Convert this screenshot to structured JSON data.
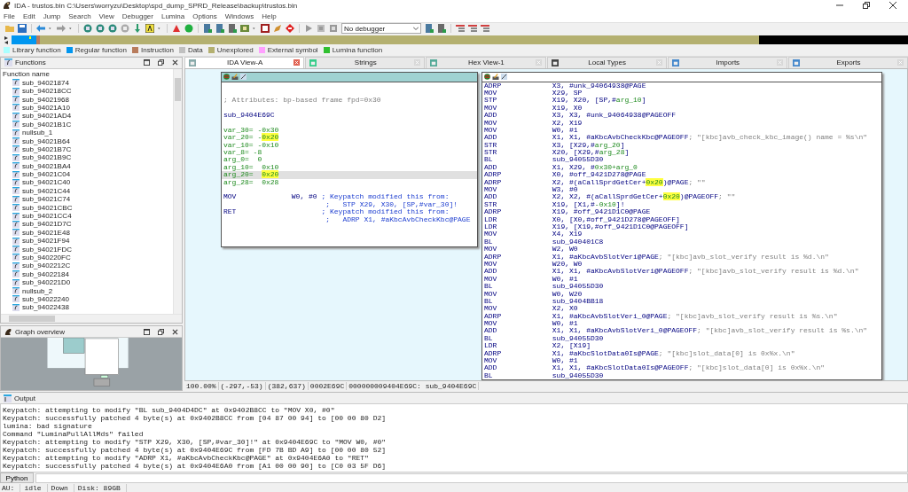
{
  "window": {
    "title": "IDA - trustos.bin C:\\Users\\worryzu\\Desktop\\spd_dump_SPRD_Release\\backup\\trustos.bin"
  },
  "menu": [
    "File",
    "Edit",
    "Jump",
    "Search",
    "View",
    "Debugger",
    "Lumina",
    "Options",
    "Windows",
    "Help"
  ],
  "toolbar": {
    "debugger": "No debugger"
  },
  "legend": [
    {
      "label": "Library function",
      "color": "#aaffff"
    },
    {
      "label": "Regular function",
      "color": "#0096f0"
    },
    {
      "label": "Instruction",
      "color": "#b87c5c"
    },
    {
      "label": "Data",
      "color": "#c0c0c0"
    },
    {
      "label": "Unexplored",
      "color": "#b4b070"
    },
    {
      "label": "External symbol",
      "color": "#ffa0ff"
    },
    {
      "label": "Lumina function",
      "color": "#30c030"
    }
  ],
  "functions": {
    "title": "Functions",
    "column": "Function name",
    "items": [
      "sub_94021874",
      "sub_940218CC",
      "sub_94021968",
      "sub_94021A10",
      "sub_94021AD4",
      "sub_94021B1C",
      "nullsub_1",
      "sub_94021B64",
      "sub_94021B7C",
      "sub_94021B9C",
      "sub_94021BA4",
      "sub_94021C04",
      "sub_94021C40",
      "sub_94021C44",
      "sub_94021C74",
      "sub_94021CBC",
      "sub_94021CC4",
      "sub_94021D7C",
      "sub_94021E48",
      "sub_94021F94",
      "sub_94021FDC",
      "sub_940220FC",
      "sub_9402212C",
      "sub_94022184",
      "sub_940221D0",
      "nullsub_2",
      "sub_94022240",
      "sub_94022438"
    ]
  },
  "graph_overview": {
    "title": "Graph overview"
  },
  "tabs": [
    {
      "label": "IDA View-A",
      "selected": true
    },
    {
      "label": "Strings",
      "selected": false
    },
    {
      "label": "Hex View-1",
      "selected": false
    },
    {
      "label": "Local Types",
      "selected": false
    },
    {
      "label": "Imports",
      "selected": false
    },
    {
      "label": "Exports",
      "selected": false
    }
  ],
  "graph": {
    "blocks": [
      {
        "selected": true,
        "lines": [
          {
            "kind": "gap",
            "selected": false
          },
          {
            "kind": "gap",
            "selected": false
          },
          {
            "kind": "text",
            "selected": false,
            "parts": [
              {
                "kind": "attr",
                "text": "; Attributes: bp-based frame fpd=0x30"
              }
            ]
          },
          {
            "kind": "gap",
            "selected": false
          },
          {
            "kind": "text",
            "selected": false,
            "parts": [
              {
                "kind": "label",
                "text": "sub_9404E69C"
              }
            ]
          },
          {
            "kind": "gap",
            "selected": false
          },
          {
            "kind": "text",
            "selected": false,
            "parts": [
              {
                "kind": "name",
                "text": "var_30= -0x30"
              }
            ]
          },
          {
            "kind": "text",
            "selected": false,
            "parts": [
              {
                "kind": "name",
                "text": "var_20= -"
              },
              {
                "kind": "hl",
                "text": "0x20"
              }
            ]
          },
          {
            "kind": "text",
            "selected": false,
            "parts": [
              {
                "kind": "name",
                "text": "var_10= -0x10"
              }
            ]
          },
          {
            "kind": "text",
            "selected": false,
            "parts": [
              {
                "kind": "name",
                "text": "var_8= -8"
              }
            ]
          },
          {
            "kind": "text",
            "selected": false,
            "parts": [
              {
                "kind": "name",
                "text": "arg_0=  0"
              }
            ]
          },
          {
            "kind": "text",
            "selected": false,
            "parts": [
              {
                "kind": "name",
                "text": "arg_10=  0x10"
              }
            ]
          },
          {
            "kind": "text",
            "selected": true,
            "parts": [
              {
                "kind": "name",
                "text": "arg_20=  "
              },
              {
                "kind": "hl",
                "text": "0x20"
              }
            ]
          },
          {
            "kind": "text",
            "selected": false,
            "parts": [
              {
                "kind": "name",
                "text": "arg_28=  0x28"
              }
            ]
          },
          {
            "kind": "gap",
            "selected": false
          },
          {
            "kind": "insn",
            "selected": false,
            "mnemonic": "MOV",
            "parts": [
              {
                "kind": "op",
                "text": "W0, #0"
              },
              {
                "kind": "user",
                "text": "; Keypatch modified this from:"
              }
            ]
          },
          {
            "kind": "cont",
            "selected": false,
            "parts": [
              {
                "kind": "user",
                "text": ";   STP X29, X30, [SP,#var_30]!"
              }
            ]
          },
          {
            "kind": "insn",
            "selected": false,
            "mnemonic": "RET",
            "parts": [
              {
                "kind": "user",
                "text": "; Keypatch modified this from:"
              }
            ]
          },
          {
            "kind": "cont",
            "selected": false,
            "parts": [
              {
                "kind": "user",
                "text": ";   ADRP X1, #aKbcAvbCheckKbc@PAGE"
              }
            ]
          }
        ]
      },
      {
        "selected": false,
        "lines": [
          {
            "kind": "insn",
            "selected": false,
            "mnemonic": "ADRP",
            "parts": [
              {
                "kind": "op",
                "text": "X3, #unk_94064938@PAGE"
              }
            ]
          },
          {
            "kind": "insn",
            "selected": false,
            "mnemonic": "MOV",
            "parts": [
              {
                "kind": "op",
                "text": "X29, SP"
              }
            ]
          },
          {
            "kind": "insn",
            "selected": false,
            "mnemonic": "STP",
            "parts": [
              {
                "kind": "op",
                "text": "X19, X20, [SP,#"
              },
              {
                "kind": "name",
                "text": "arg_10"
              },
              {
                "kind": "op",
                "text": "]"
              }
            ]
          },
          {
            "kind": "insn",
            "selected": false,
            "mnemonic": "MOV",
            "parts": [
              {
                "kind": "op",
                "text": "X19, X0"
              }
            ]
          },
          {
            "kind": "insn",
            "selected": false,
            "mnemonic": "ADD",
            "parts": [
              {
                "kind": "op",
                "text": "X3, X3, #unk_94064938@PAGEOFF"
              }
            ]
          },
          {
            "kind": "insn",
            "selected": false,
            "mnemonic": "MOV",
            "parts": [
              {
                "kind": "op",
                "text": "X2, X19"
              }
            ]
          },
          {
            "kind": "insn",
            "selected": false,
            "mnemonic": "MOV",
            "parts": [
              {
                "kind": "op",
                "text": "W0, #1"
              }
            ]
          },
          {
            "kind": "insn",
            "selected": false,
            "mnemonic": "ADD",
            "parts": [
              {
                "kind": "op",
                "text": "X1, X1, #aKbcAvbCheckKbc@PAGEOFF"
              },
              {
                "kind": "str",
                "text": "; \"[kbc]avb_check_kbc_image() name = %s\\n\""
              }
            ]
          },
          {
            "kind": "insn",
            "selected": false,
            "mnemonic": "STR",
            "parts": [
              {
                "kind": "op",
                "text": "X3, [X29,#"
              },
              {
                "kind": "name",
                "text": "arg_20"
              },
              {
                "kind": "op",
                "text": "]"
              }
            ]
          },
          {
            "kind": "insn",
            "selected": false,
            "mnemonic": "STR",
            "parts": [
              {
                "kind": "op",
                "text": "X20, [X29,#"
              },
              {
                "kind": "name",
                "text": "arg_28"
              },
              {
                "kind": "op",
                "text": "]"
              }
            ]
          },
          {
            "kind": "insn",
            "selected": false,
            "mnemonic": "BL",
            "parts": [
              {
                "kind": "op",
                "text": "sub_94055D30"
              }
            ]
          },
          {
            "kind": "insn",
            "selected": false,
            "mnemonic": "ADD",
            "parts": [
              {
                "kind": "op",
                "text": "X1, X29, #"
              },
              {
                "kind": "name",
                "text": "0x30+arg_0"
              }
            ]
          },
          {
            "kind": "insn",
            "selected": false,
            "mnemonic": "ADRP",
            "parts": [
              {
                "kind": "op",
                "text": "X0, #off_9421D278@PAGE"
              }
            ]
          },
          {
            "kind": "insn",
            "selected": false,
            "mnemonic": "ADRP",
            "parts": [
              {
                "kind": "op",
                "text": "X2, #(aCallSprdGetCer+"
              },
              {
                "kind": "hl",
                "text": "0x20"
              },
              {
                "kind": "op",
                "text": ")@PAGE"
              },
              {
                "kind": "str",
                "text": "; \"\""
              }
            ]
          },
          {
            "kind": "insn",
            "selected": false,
            "mnemonic": "MOV",
            "parts": [
              {
                "kind": "op",
                "text": "W3, #0"
              }
            ]
          },
          {
            "kind": "insn",
            "selected": false,
            "mnemonic": "ADD",
            "parts": [
              {
                "kind": "op",
                "text": "X2, X2, #(aCallSprdGetCer+"
              },
              {
                "kind": "hl",
                "text": "0x20"
              },
              {
                "kind": "op",
                "text": ")@PAGEOFF"
              },
              {
                "kind": "str",
                "text": "; \"\""
              }
            ]
          },
          {
            "kind": "insn",
            "selected": false,
            "mnemonic": "STR",
            "parts": [
              {
                "kind": "op",
                "text": "X19, [X1,#"
              },
              {
                "kind": "name",
                "text": "-0x10"
              },
              {
                "kind": "op",
                "text": "]!"
              }
            ]
          },
          {
            "kind": "insn",
            "selected": false,
            "mnemonic": "ADRP",
            "parts": [
              {
                "kind": "op",
                "text": "X19, #off_9421D1C0@PAGE"
              }
            ]
          },
          {
            "kind": "insn",
            "selected": false,
            "mnemonic": "LDR",
            "parts": [
              {
                "kind": "op",
                "text": "X0, [X0,#off_9421D278@PAGEOFF]"
              }
            ]
          },
          {
            "kind": "insn",
            "selected": false,
            "mnemonic": "LDR",
            "parts": [
              {
                "kind": "op",
                "text": "X19, [X19,#off_9421D1C0@PAGEOFF]"
              }
            ]
          },
          {
            "kind": "insn",
            "selected": false,
            "mnemonic": "MOV",
            "parts": [
              {
                "kind": "op",
                "text": "X4, X19"
              }
            ]
          },
          {
            "kind": "insn",
            "selected": false,
            "mnemonic": "BL",
            "parts": [
              {
                "kind": "op",
                "text": "sub_940401C8"
              }
            ]
          },
          {
            "kind": "insn",
            "selected": false,
            "mnemonic": "MOV",
            "parts": [
              {
                "kind": "op",
                "text": "W2, W0"
              }
            ]
          },
          {
            "kind": "insn",
            "selected": false,
            "mnemonic": "ADRP",
            "parts": [
              {
                "kind": "op",
                "text": "X1, #aKbcAvbSlotVeri@PAGE"
              },
              {
                "kind": "str",
                "text": "; \"[kbc]avb_slot_verify result is %d.\\n\""
              }
            ]
          },
          {
            "kind": "insn",
            "selected": false,
            "mnemonic": "MOV",
            "parts": [
              {
                "kind": "op",
                "text": "W20, W0"
              }
            ]
          },
          {
            "kind": "insn",
            "selected": false,
            "mnemonic": "ADD",
            "parts": [
              {
                "kind": "op",
                "text": "X1, X1, #aKbcAvbSlotVeri@PAGEOFF"
              },
              {
                "kind": "str",
                "text": "; \"[kbc]avb_slot_verify result is %d.\\n\""
              }
            ]
          },
          {
            "kind": "insn",
            "selected": false,
            "mnemonic": "MOV",
            "parts": [
              {
                "kind": "op",
                "text": "W0, #1"
              }
            ]
          },
          {
            "kind": "insn",
            "selected": false,
            "mnemonic": "BL",
            "parts": [
              {
                "kind": "op",
                "text": "sub_94055D30"
              }
            ]
          },
          {
            "kind": "insn",
            "selected": false,
            "mnemonic": "MOV",
            "parts": [
              {
                "kind": "op",
                "text": "W0, W20"
              }
            ]
          },
          {
            "kind": "insn",
            "selected": false,
            "mnemonic": "BL",
            "parts": [
              {
                "kind": "op",
                "text": "sub_9404BB18"
              }
            ]
          },
          {
            "kind": "insn",
            "selected": false,
            "mnemonic": "MOV",
            "parts": [
              {
                "kind": "op",
                "text": "X2, X0"
              }
            ]
          },
          {
            "kind": "insn",
            "selected": false,
            "mnemonic": "ADRP",
            "parts": [
              {
                "kind": "op",
                "text": "X1, #aKbcAvbSlotVeri_0@PAGE"
              },
              {
                "kind": "str",
                "text": "; \"[kbc]avb_slot_verify result is %s.\\n\""
              }
            ]
          },
          {
            "kind": "insn",
            "selected": false,
            "mnemonic": "MOV",
            "parts": [
              {
                "kind": "op",
                "text": "W0, #1"
              }
            ]
          },
          {
            "kind": "insn",
            "selected": false,
            "mnemonic": "ADD",
            "parts": [
              {
                "kind": "op",
                "text": "X1, X1, #aKbcAvbSlotVeri_0@PAGEOFF"
              },
              {
                "kind": "str",
                "text": "; \"[kbc]avb_slot_verify result is %s.\\n\""
              }
            ]
          },
          {
            "kind": "insn",
            "selected": false,
            "mnemonic": "BL",
            "parts": [
              {
                "kind": "op",
                "text": "sub_94055D30"
              }
            ]
          },
          {
            "kind": "insn",
            "selected": false,
            "mnemonic": "LDR",
            "parts": [
              {
                "kind": "op",
                "text": "X2, [X19]"
              }
            ]
          },
          {
            "kind": "insn",
            "selected": false,
            "mnemonic": "ADRP",
            "parts": [
              {
                "kind": "op",
                "text": "X1, #aKbcSlotData0Is@PAGE"
              },
              {
                "kind": "str",
                "text": "; \"[kbc]slot_data[0] is 0x%x.\\n\""
              }
            ]
          },
          {
            "kind": "insn",
            "selected": false,
            "mnemonic": "MOV",
            "parts": [
              {
                "kind": "op",
                "text": "W0, #1"
              }
            ]
          },
          {
            "kind": "insn",
            "selected": false,
            "mnemonic": "ADD",
            "parts": [
              {
                "kind": "op",
                "text": "X1, X1, #aKbcSlotData0Is@PAGEOFF"
              },
              {
                "kind": "str",
                "text": "; \"[kbc]slot_data[0] is 0x%x.\\n\""
              }
            ]
          },
          {
            "kind": "insn",
            "selected": false,
            "mnemonic": "BL",
            "parts": [
              {
                "kind": "op",
                "text": "sub_94055D30"
              }
            ]
          }
        ]
      }
    ]
  },
  "view_status": [
    "100.00%",
    "(-297,-53)",
    "(382,637)",
    "0002E69C",
    "000000009404E69C: sub_9404E69C"
  ],
  "output": {
    "title": "Output",
    "lines": [
      "Keypatch: attempting to modify \"BL sub_9404D4DC\" at 0x9402B8CC to \"MOV X0, #0\"",
      "Keypatch: successfully patched 4 byte(s) at 0x9402B8CC from [04 87 00 94] to [00 00 80 D2]",
      "lumina: bad signature",
      "Command \"LuminaPullAllMds\" failed",
      "Keypatch: attempting to modify \"STP X29, X30, [SP,#var_30]!\" at 0x9404E69C to \"MOV W0, #0\"",
      "Keypatch: successfully patched 4 byte(s) at 0x9404E69C from [FD 7B BD A9] to [00 00 80 52]",
      "Keypatch: attempting to modify \"ADRP X1, #aKbcAvbCheckKbc@PAGE\" at 0x9404E6A0 to \"RET\"",
      "Keypatch: successfully patched 4 byte(s) at 0x9404E6A0 from [A1 00 00 90] to [C0 03 5F D6]"
    ],
    "button": "Python"
  },
  "status_bar": [
    "AU:",
    "idle",
    "Down",
    "Disk: 89GB"
  ]
}
